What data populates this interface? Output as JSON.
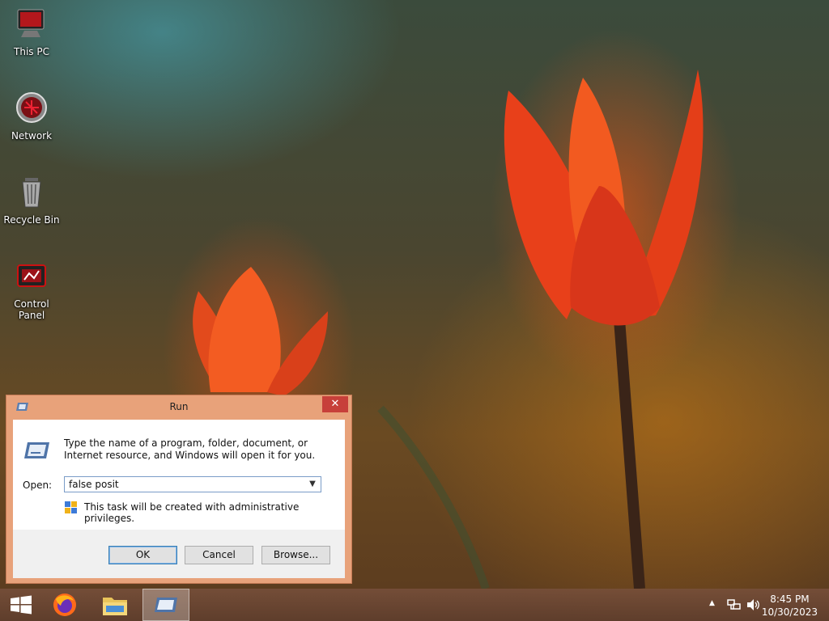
{
  "desktop": {
    "icons": [
      {
        "label": "This PC"
      },
      {
        "label": "Network"
      },
      {
        "label": "Recycle Bin"
      },
      {
        "label": "Control Panel"
      }
    ]
  },
  "run_dialog": {
    "title": "Run",
    "close_glyph": "✕",
    "description": "Type the name of a program, folder, document, or Internet resource, and Windows will open it for you.",
    "open_label": "Open:",
    "open_value": "false posit",
    "admin_note": "This task will be created with administrative privileges.",
    "buttons": {
      "ok": "OK",
      "cancel": "Cancel",
      "browse": "Browse..."
    }
  },
  "taskbar": {
    "pinned": [
      "start-icon",
      "firefox-icon",
      "file-explorer-icon",
      "run-icon"
    ],
    "clock": {
      "time": "8:45 PM",
      "date": "10/30/2023"
    }
  },
  "colors": {
    "dialog_frame": "#e8a27a",
    "close_button": "#c7403a",
    "default_button_border": "#3c7fb1"
  }
}
